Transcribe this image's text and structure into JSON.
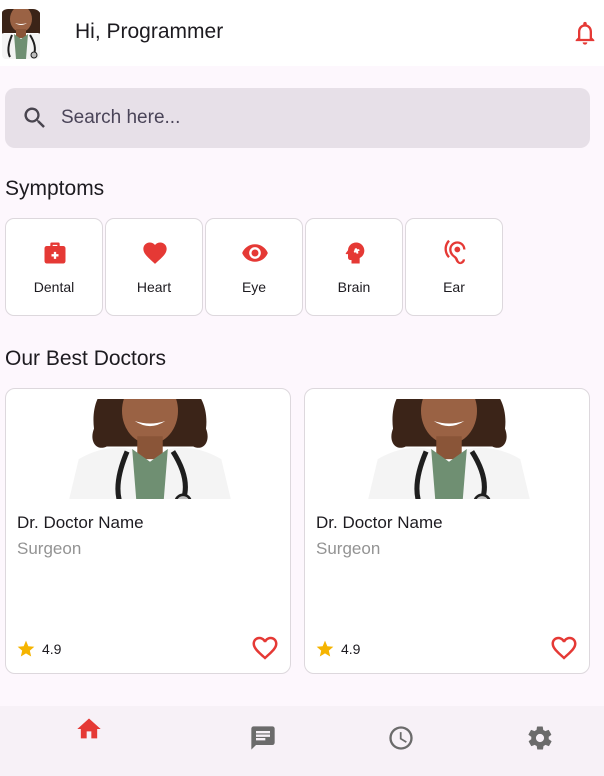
{
  "header": {
    "greeting": "Hi, Programmer",
    "avatar_icon": "doctor-avatar",
    "notification_icon": "bell-icon"
  },
  "search": {
    "placeholder": "Search here...",
    "value": "",
    "icon": "search-icon"
  },
  "symptoms": {
    "title": "Symptoms",
    "items": [
      {
        "label": "Dental",
        "icon": "medical-kit-icon"
      },
      {
        "label": "Heart",
        "icon": "heart-icon"
      },
      {
        "label": "Eye",
        "icon": "eye-icon"
      },
      {
        "label": "Brain",
        "icon": "brain-icon"
      },
      {
        "label": "Ear",
        "icon": "ear-icon"
      }
    ]
  },
  "doctors": {
    "title": "Our Best Doctors",
    "items": [
      {
        "name": "Dr. Doctor Name",
        "specialty": "Surgeon",
        "rating": "4.9"
      },
      {
        "name": "Dr. Doctor Name",
        "specialty": "Surgeon",
        "rating": "4.9"
      }
    ]
  },
  "bottom_nav": {
    "items": [
      {
        "icon": "home-icon",
        "active": true
      },
      {
        "icon": "chat-icon",
        "active": false
      },
      {
        "icon": "history-clock-icon",
        "active": false
      },
      {
        "icon": "settings-gear-icon",
        "active": false
      }
    ]
  },
  "colors": {
    "accent": "#e53935",
    "background": "#fdf7fd",
    "search_bg": "#e7e0e8",
    "star": "#f5b400",
    "inactive_icon": "#6b6b6b"
  }
}
